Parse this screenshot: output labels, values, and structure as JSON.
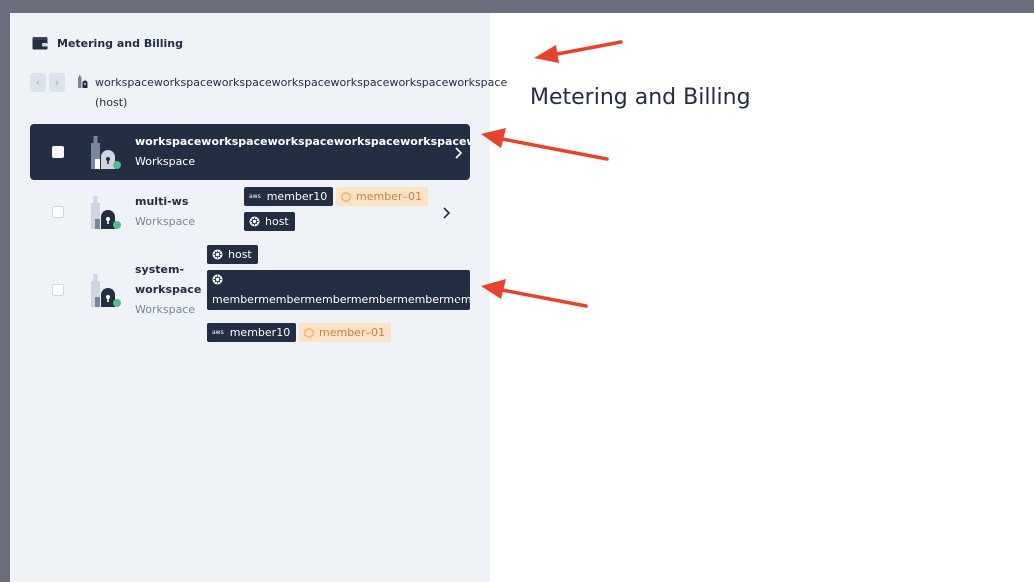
{
  "sidebar": {
    "title": "Metering and Billing",
    "nav_prev": "‹",
    "nav_next": "›",
    "current_workspace": "workspaceworkspaceworkspaceworkspaceworkspaceworkspaceworkspace (host)",
    "workspaces": [
      {
        "name": "workspaceworkspaceworkspaceworkspaceworkspaceworkspa",
        "type": "Workspace",
        "selected": true
      },
      {
        "name": "multi-ws",
        "type": "Workspace",
        "tags": [
          {
            "label": "member10",
            "style": "dark",
            "icon": "aws-icon"
          },
          {
            "label": "member–01",
            "style": "peach",
            "icon": "hexagon-icon"
          },
          {
            "label": "host",
            "style": "dark",
            "icon": "kubernetes-icon"
          }
        ]
      },
      {
        "name_line1": "system-",
        "name_line2": "workspace",
        "type": "Workspace",
        "tags": [
          {
            "label": "host",
            "style": "dark",
            "icon": "kubernetes-icon"
          },
          {
            "label": "membermembermembermembermembermem",
            "style": "dark",
            "icon": "kubernetes-icon"
          },
          {
            "label": "member10",
            "style": "dark",
            "icon": "aws-icon"
          },
          {
            "label": "member–01",
            "style": "peach",
            "icon": "hexagon-icon"
          }
        ]
      }
    ]
  },
  "main": {
    "title": "Metering and Billing"
  },
  "colors": {
    "dark": "#242e42",
    "sidebar_bg": "#eff3f8",
    "peach": "#fde3c6",
    "status_green": "#55bc8a",
    "annotation_red": "#e8412c"
  }
}
